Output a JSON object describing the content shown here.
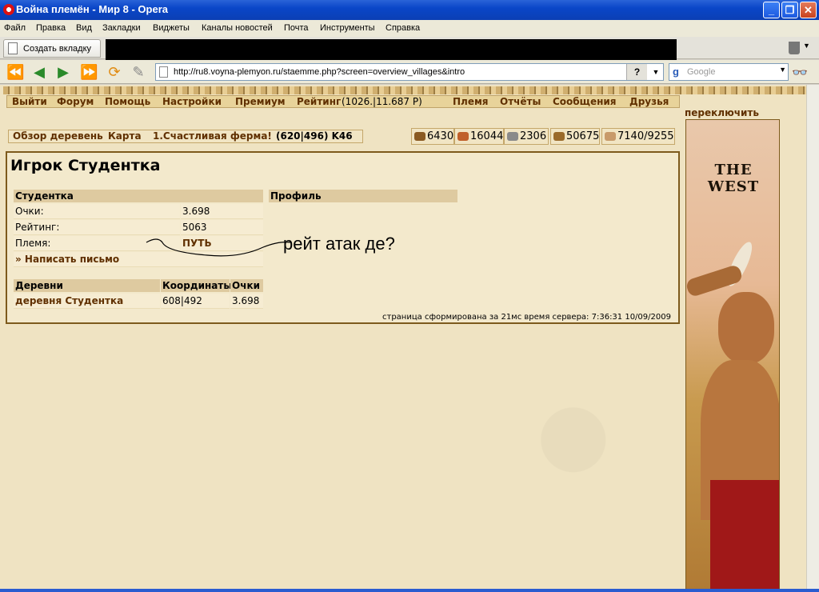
{
  "window": {
    "title": "Война племён - Мир 8 - Opera"
  },
  "menubar": [
    "Файл",
    "Правка",
    "Вид",
    "Закладки",
    "Виджеты",
    "Каналы новостей",
    "Почта",
    "Инструменты",
    "Справка"
  ],
  "tabbar": {
    "new_tab": "Создать вкладку"
  },
  "address": {
    "url": "http://ru8.voyna-plemyon.ru/staemme.php?screen=overview_villages&intro",
    "help": "?",
    "search_placeholder": "Google"
  },
  "game_menu": {
    "items": [
      "Выйти",
      "Форум",
      "Помощь",
      "Настройки",
      "Премиум",
      "Рейтинг",
      "(1026.|11.687 P)",
      "Племя",
      "Отчёты",
      "Сообщения",
      "Друзья"
    ]
  },
  "switch": "переключить",
  "breadcrumb": {
    "overview": "Обзор деревень",
    "map": "Карта",
    "village": "1.Счастливая ферма!",
    "coords": "(620|496) K46"
  },
  "resources": [
    {
      "icon": "wood-icon",
      "value": "6430",
      "color": "#8a5a22"
    },
    {
      "icon": "clay-icon",
      "value": "16044",
      "color": "#c0602a"
    },
    {
      "icon": "iron-icon",
      "value": "2306",
      "color": "#8a8a8a"
    },
    {
      "icon": "storage-icon",
      "value": "50675",
      "color": "#9a6a2a"
    },
    {
      "icon": "population-icon",
      "value": "7140/9255",
      "color": "#c89a6a"
    }
  ],
  "player": {
    "heading": "Игрок Студентка",
    "table_header": "Студентка",
    "profile_header": "Профиль",
    "rows": [
      {
        "label": "Очки:",
        "value": "3.698"
      },
      {
        "label": "Рейтинг:",
        "value": "5063"
      },
      {
        "label": "Племя:",
        "value": "ПУТЬ"
      }
    ],
    "write_letter": "» Написать письмо"
  },
  "villages": {
    "headers": [
      "Деревни",
      "Координаты",
      "Очки"
    ],
    "rows": [
      {
        "name": "деревня Студентка",
        "coords": "608|492",
        "points": "3.698"
      }
    ]
  },
  "annotation": "рейт атак де?",
  "footer": "страница сформирована за 21мс время сервера: 7:36:31 10/09/2009",
  "ad": {
    "logo": "THE WEST"
  }
}
